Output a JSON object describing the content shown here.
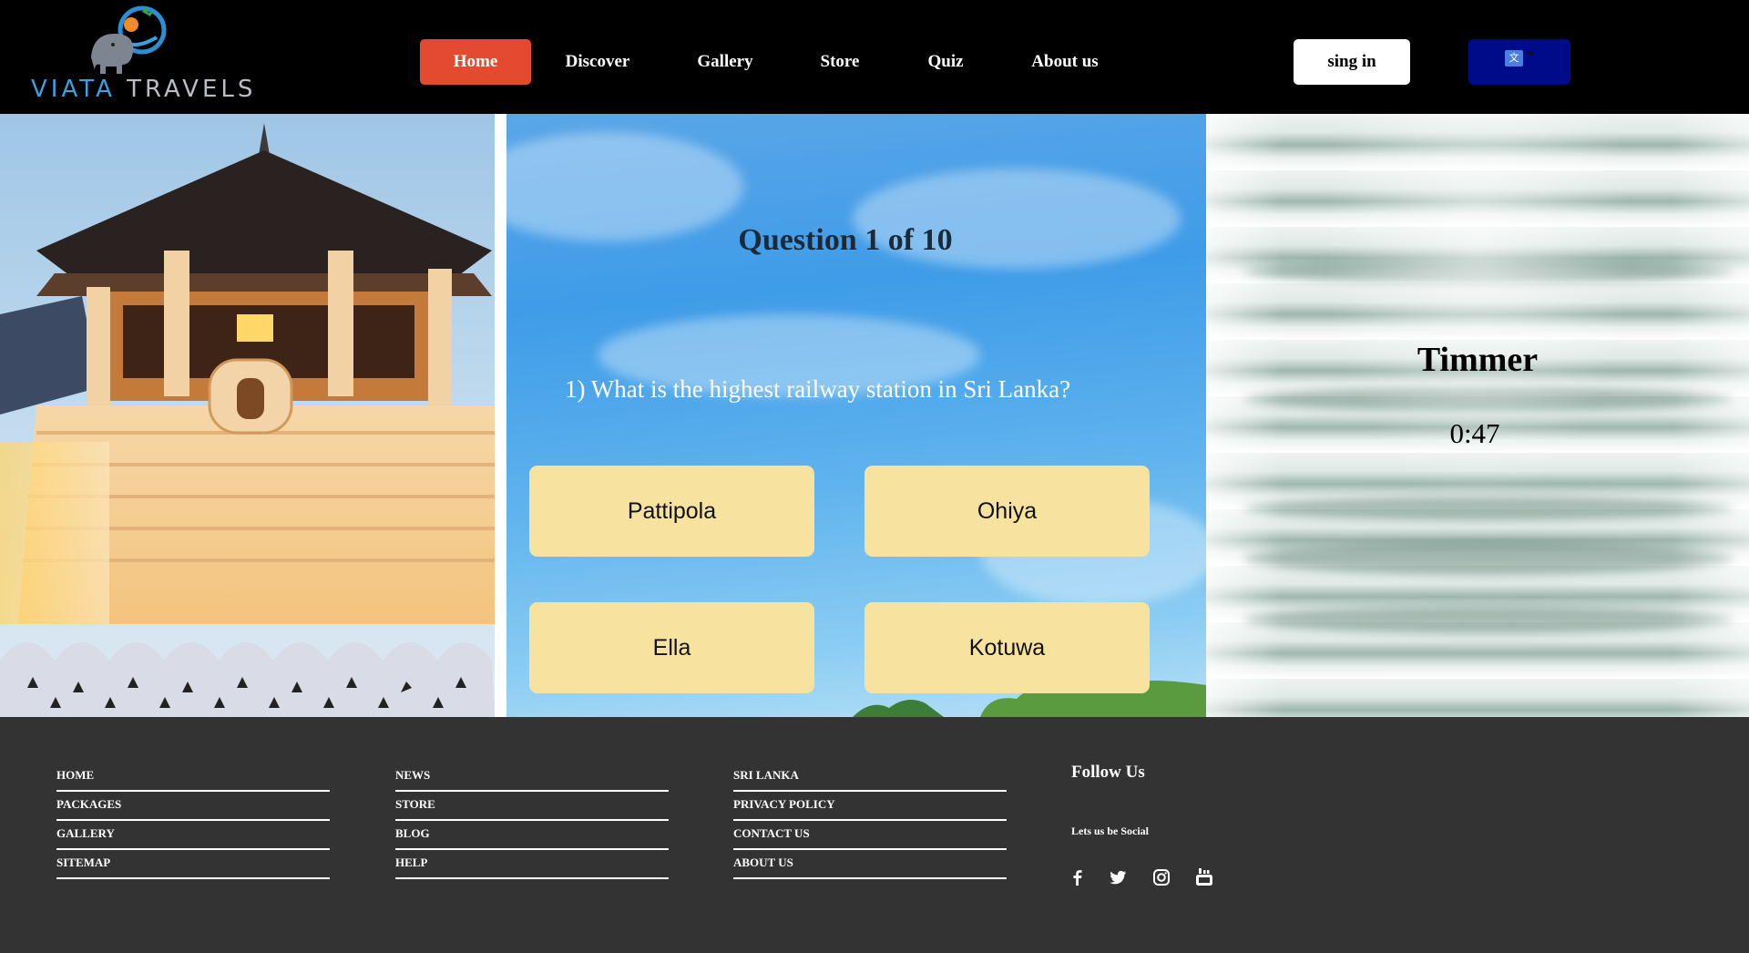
{
  "nav": {
    "logo_text_part1": "VIATA",
    "logo_text_part2": "TRAVELS",
    "items": [
      {
        "label": "Home",
        "active": true
      },
      {
        "label": "Discover",
        "active": false
      },
      {
        "label": "Gallery",
        "active": false
      },
      {
        "label": "Store",
        "active": false
      },
      {
        "label": "Quiz",
        "active": false
      },
      {
        "label": "About us",
        "active": false
      }
    ],
    "signin_label": "sing in",
    "translate_icon": "google-translate-icon"
  },
  "quiz": {
    "title": "Question 1 of 10",
    "question": "1) What is the highest railway station in Sri Lanka?",
    "answers": [
      "Pattipola",
      "Ohiya",
      "Ella",
      "Kotuwa"
    ]
  },
  "timer": {
    "label": "Timmer",
    "value": "0:47"
  },
  "footer": {
    "columns": [
      [
        "HOME",
        "PACKAGES",
        "GALLERY",
        "SITEMAP"
      ],
      [
        "NEWS",
        "STORE",
        "BLOG",
        "HELP"
      ],
      [
        "SRI LANKA",
        "PRIVACY POLICY",
        "CONTACT US",
        "ABOUT US"
      ]
    ],
    "follow_title": "Follow Us",
    "follow_sub": "Lets us be Social",
    "social_icons": [
      "facebook-icon",
      "twitter-icon",
      "instagram-icon",
      "youtube-icon"
    ]
  },
  "colors": {
    "nav_bg": "#000000",
    "active_nav": "#e34a2f",
    "answer_bg": "#f7e39f",
    "footer_bg": "#333333",
    "lang_button": "#000b8a"
  }
}
